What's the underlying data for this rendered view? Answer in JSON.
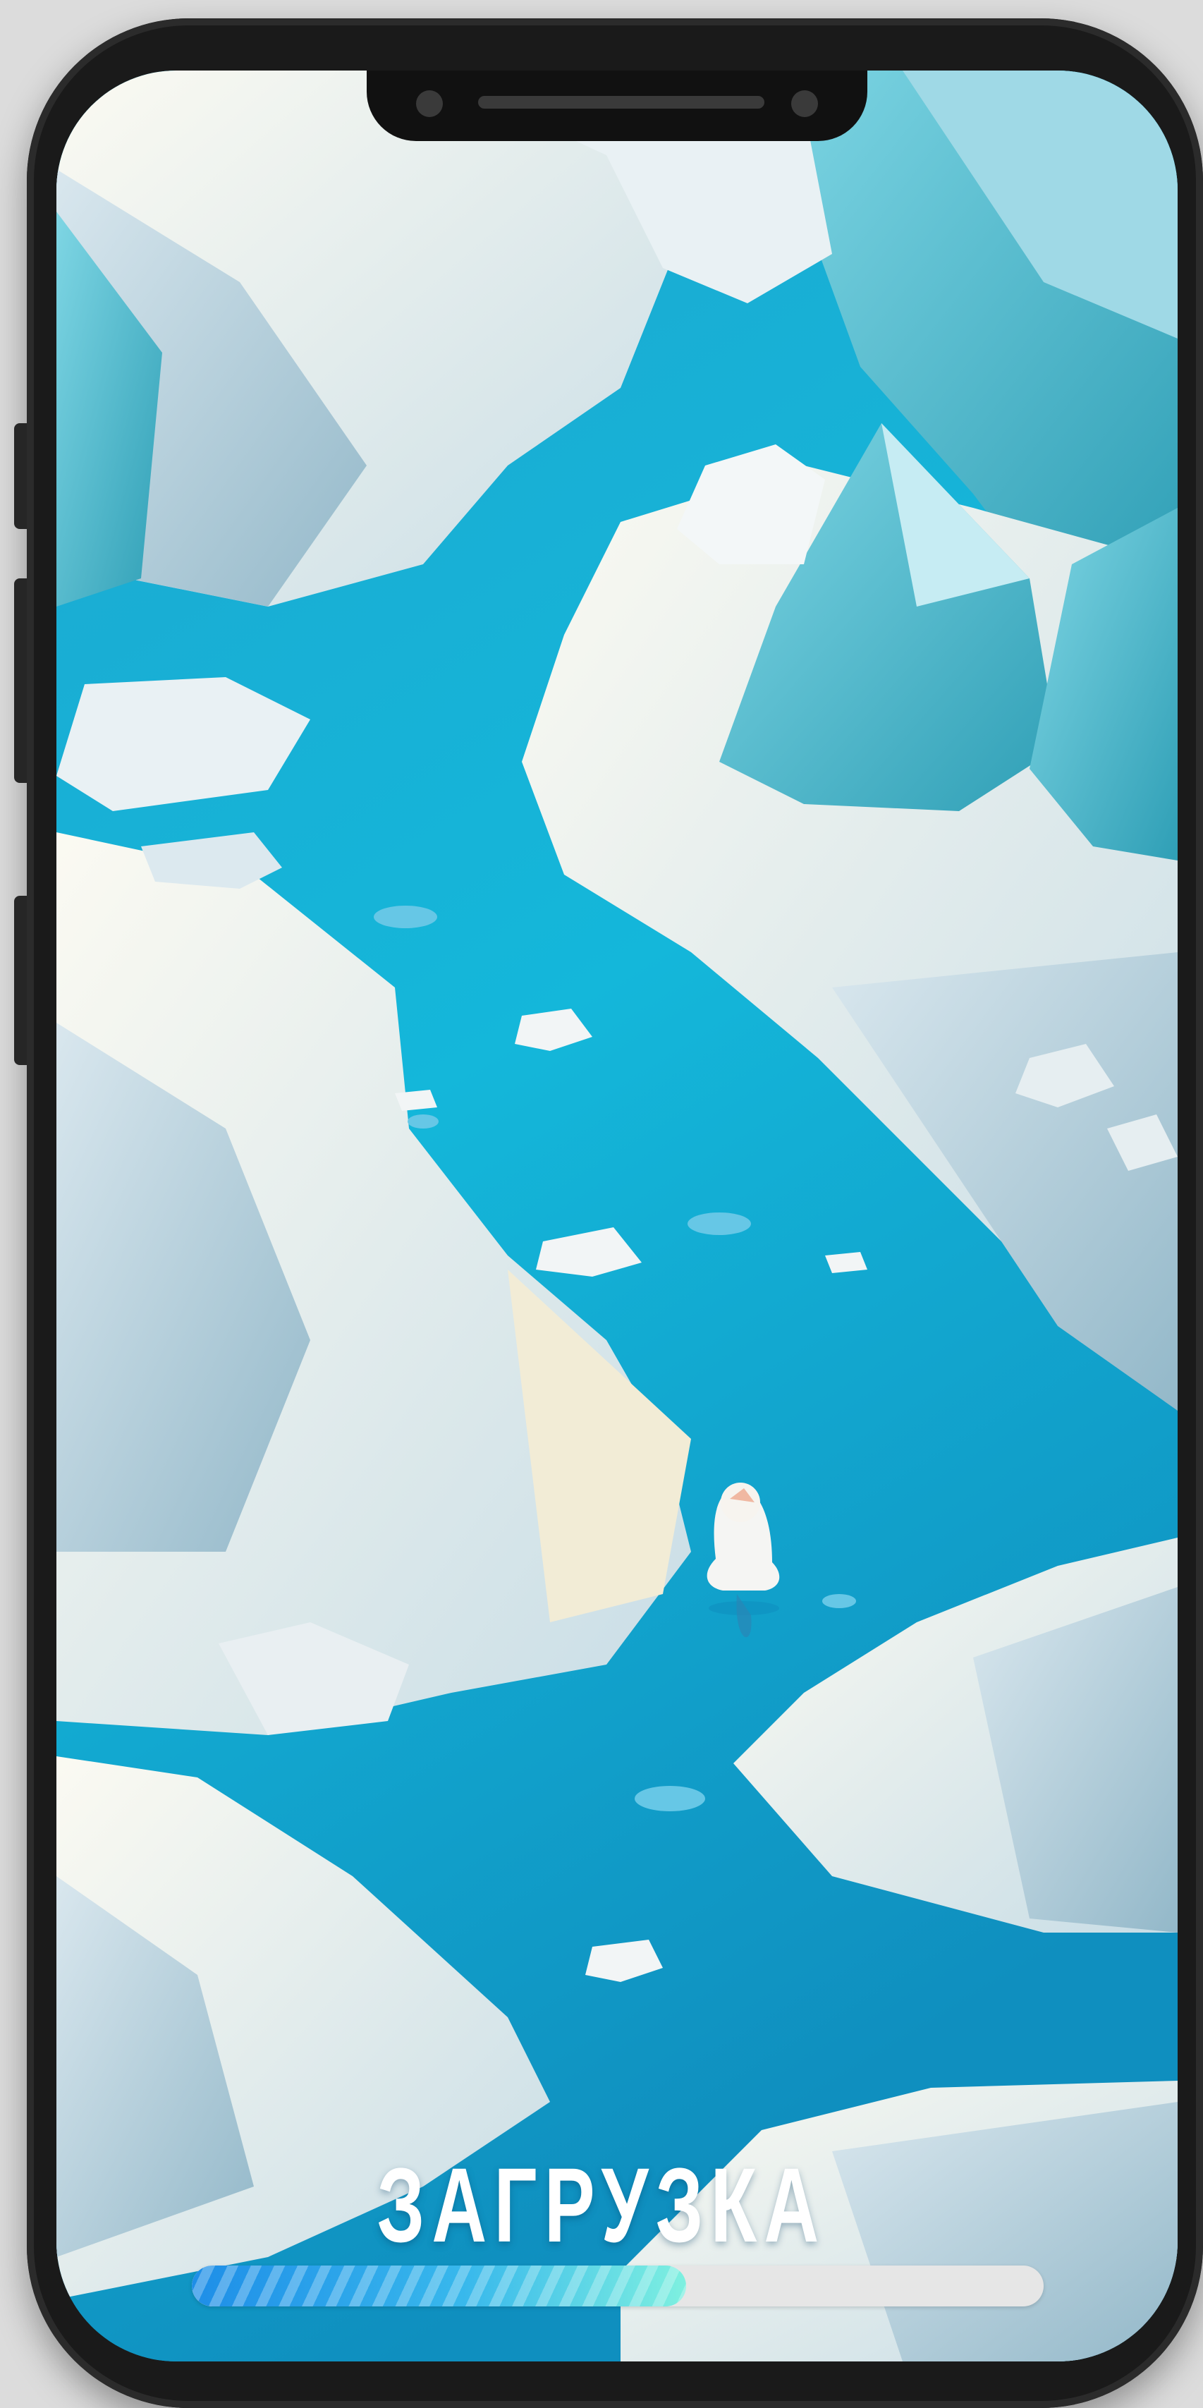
{
  "loading": {
    "label": "ЗАГРУЗКА",
    "progress": 0.58
  },
  "scene": {
    "description_icon": "penguin-icon",
    "colors": {
      "water": "#19a4cc",
      "water_light": "#3cc6e2",
      "ice": "#eef4f6",
      "ice_shadow": "#b9d2dc",
      "ice_teal": "#4fb8c8"
    }
  },
  "colors": {
    "progress_start": "#1e8ee8",
    "progress_end": "#7ef0e0",
    "track": "#e6e6e6",
    "frame": "#1a1a1a"
  }
}
